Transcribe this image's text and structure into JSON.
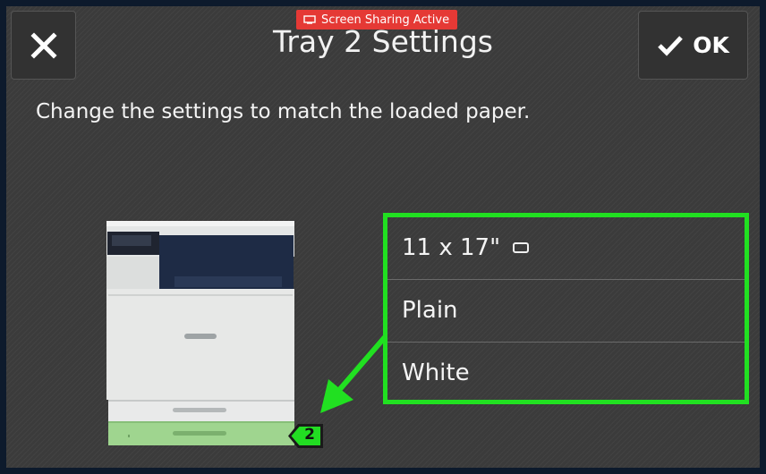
{
  "badge": {
    "label": "Screen Sharing Active",
    "icon": "screen-share-icon"
  },
  "header": {
    "title": "Tray 2 Settings",
    "close_icon": "close-icon",
    "ok_label": "OK",
    "ok_icon": "checkmark-icon"
  },
  "instruction": "Change the settings to match the loaded paper.",
  "settings": {
    "rows": [
      {
        "label": "11 x 17\"",
        "icon": "landscape-orientation-icon"
      },
      {
        "label": "Plain"
      },
      {
        "label": "White"
      }
    ]
  },
  "tray": {
    "number": "2"
  },
  "colors": {
    "highlight": "#21e021",
    "badge": "#e53935",
    "background": "#3b3b3b",
    "tray_highlight": "#9fd58f"
  }
}
